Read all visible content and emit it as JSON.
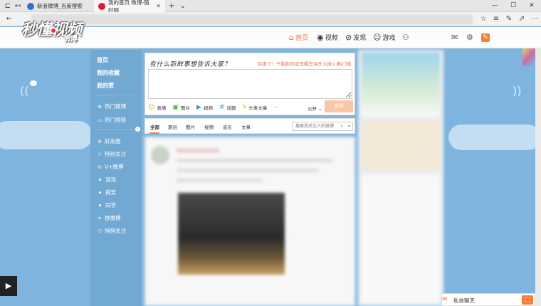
{
  "browser": {
    "tabs": [
      {
        "title": "新浪微博_百度搜索",
        "favicon_color": "#2f6fd6",
        "active": false
      },
      {
        "title": "我的首页 微博-随时随",
        "favicon_color": "#e6162d",
        "active": true
      }
    ],
    "new_tab_glyph": "+",
    "tab_list_glyph": "⌄",
    "back_glyph": "←",
    "window_buttons": {
      "minimize": "—",
      "maximize": "☐",
      "close": "✕"
    }
  },
  "watermark": {
    "logo_text": "秒懂视频",
    "sub_text": "微博"
  },
  "topnav": {
    "items": [
      {
        "label": "首页",
        "icon": "home-icon",
        "glyph": "⌂",
        "active": true
      },
      {
        "label": "视频",
        "icon": "video-icon",
        "glyph": "◉",
        "active": false
      },
      {
        "label": "发现",
        "icon": "compass-icon",
        "glyph": "⊘",
        "active": false
      },
      {
        "label": "游戏",
        "icon": "gamepad-icon",
        "glyph": "☺",
        "active": false
      }
    ],
    "user_glyph": "⚇",
    "mail_glyph": "✉",
    "settings_glyph": "⚙",
    "compose_glyph": "✎"
  },
  "leftnav": {
    "primary": [
      {
        "label": "首页"
      },
      {
        "label": "我的收藏"
      },
      {
        "label": "我的赞"
      }
    ],
    "hot": [
      {
        "label": "热门微博",
        "glyph": "⊕"
      },
      {
        "label": "热门视频",
        "glyph": "▭"
      }
    ],
    "groups": [
      {
        "label": "好友圈",
        "glyph": "⊚",
        "type": "icon"
      },
      {
        "label": "特别关注",
        "glyph": "☆",
        "type": "icon"
      },
      {
        "label": "V+微博",
        "glyph": "⊙",
        "type": "icon"
      },
      {
        "label": "游戏",
        "type": "dot"
      },
      {
        "label": "搞笑",
        "type": "dot"
      },
      {
        "label": "同学",
        "type": "dot"
      },
      {
        "label": "群微博",
        "glyph": "⚭",
        "type": "icon"
      },
      {
        "label": "悄悄关注",
        "glyph": "⚇",
        "type": "icon"
      }
    ],
    "collapse_glyph": "‹"
  },
  "compose": {
    "title": "有什么新鲜事想告诉大家？",
    "promo": "厉害了！千脑和邓成李曝官海天大楼>>",
    "hot_topic": "热门微博",
    "tools": [
      {
        "label": "表情",
        "icon": "emoji-icon",
        "glyph": "☺",
        "color": "yellow"
      },
      {
        "label": "图片",
        "icon": "image-icon",
        "glyph": "▣",
        "color": "green"
      },
      {
        "label": "视频",
        "icon": "video-icon",
        "glyph": "▶",
        "color": "blue"
      },
      {
        "label": "话题",
        "icon": "hashtag-icon",
        "glyph": "#",
        "color": "blue"
      },
      {
        "label": "头条文章",
        "icon": "lightning-icon",
        "glyph": "ϟ",
        "color": "orange"
      },
      {
        "label": "···",
        "icon": "more-icon",
        "glyph": "",
        "color": ""
      }
    ],
    "visibility": "公开 ⌄",
    "submit": "发布"
  },
  "feed_tabs": {
    "tabs": [
      "全部",
      "原创",
      "图片",
      "视频",
      "音乐",
      "文章"
    ],
    "search_placeholder": "搜索我关注人的微博",
    "search_glyph": "⌕",
    "dropdown_glyph": "▾"
  },
  "chat": {
    "label": "私信聊天",
    "icon_glyph": "✉",
    "button_glyph": "☐"
  },
  "player": {
    "play_glyph": "▶"
  }
}
